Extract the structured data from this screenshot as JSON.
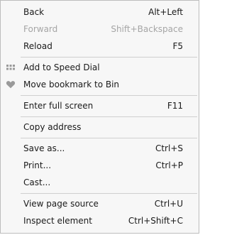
{
  "menu": {
    "items": [
      {
        "label": "Back",
        "shortcut": "Alt+Left"
      },
      {
        "label": "Forward",
        "shortcut": "Shift+Backspace",
        "disabled": true
      },
      {
        "label": "Reload",
        "shortcut": "F5"
      },
      {
        "label": "Add to Speed Dial",
        "shortcut": "",
        "icon": "speed-dial-grid-icon"
      },
      {
        "label": "Move bookmark to Bin",
        "shortcut": "",
        "icon": "heart-icon"
      },
      {
        "label": "Enter full screen",
        "shortcut": "F11"
      },
      {
        "label": "Copy address",
        "shortcut": ""
      },
      {
        "label": "Save as...",
        "shortcut": "Ctrl+S"
      },
      {
        "label": "Print...",
        "shortcut": "Ctrl+P"
      },
      {
        "label": "Cast...",
        "shortcut": ""
      },
      {
        "label": "View page source",
        "shortcut": "Ctrl+U"
      },
      {
        "label": "Inspect element",
        "shortcut": "Ctrl+Shift+C"
      }
    ]
  },
  "colors": {
    "background": "#f7f7f7",
    "text": "#1a1a1a",
    "disabled_text": "#a5a5a5",
    "separator": "#cfcfcf",
    "icon": "#9a9a9a"
  }
}
